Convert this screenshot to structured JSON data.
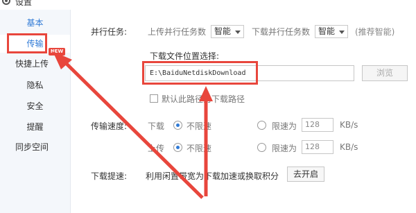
{
  "window": {
    "title": "设置"
  },
  "sidebar": {
    "items": [
      {
        "label": "基本"
      },
      {
        "label": "传输"
      },
      {
        "label": "快捷上传"
      },
      {
        "label": "隐私"
      },
      {
        "label": "安全"
      },
      {
        "label": "提醒"
      },
      {
        "label": "同步空间"
      }
    ],
    "new_badge": "NEW"
  },
  "parallel": {
    "label": "并行任务:",
    "upload_label": "上传并行任务数",
    "upload_value": "智能",
    "download_label": "下载并行任务数",
    "download_value": "智能",
    "hint": "(推荐智能)"
  },
  "download_location": {
    "label": "下载文件位置选择:",
    "path": "E:\\BaiduNetdiskDownload",
    "browse_button": "浏览",
    "default_checkbox_label": "默认此路径为下载路径",
    "default_checked": false
  },
  "speed": {
    "label": "传输速度:",
    "download": {
      "label": "下载",
      "unlimited": "不限速",
      "limit_to": "限速为",
      "value": "128",
      "unit": "KB/s"
    },
    "upload": {
      "label": "上传",
      "unlimited": "不限速",
      "limit_to": "限速为",
      "value": "128",
      "unit": "KB/s"
    }
  },
  "boost": {
    "label": "下载提速:",
    "text": "利用闲置带宽为下载加速或换取积分",
    "button": "去开启"
  },
  "colors": {
    "accent": "#2f7ad6",
    "highlight": "#e8463c",
    "sidebar_bg": "#f4f7fb"
  },
  "icons": {
    "title": "gear-icon"
  }
}
